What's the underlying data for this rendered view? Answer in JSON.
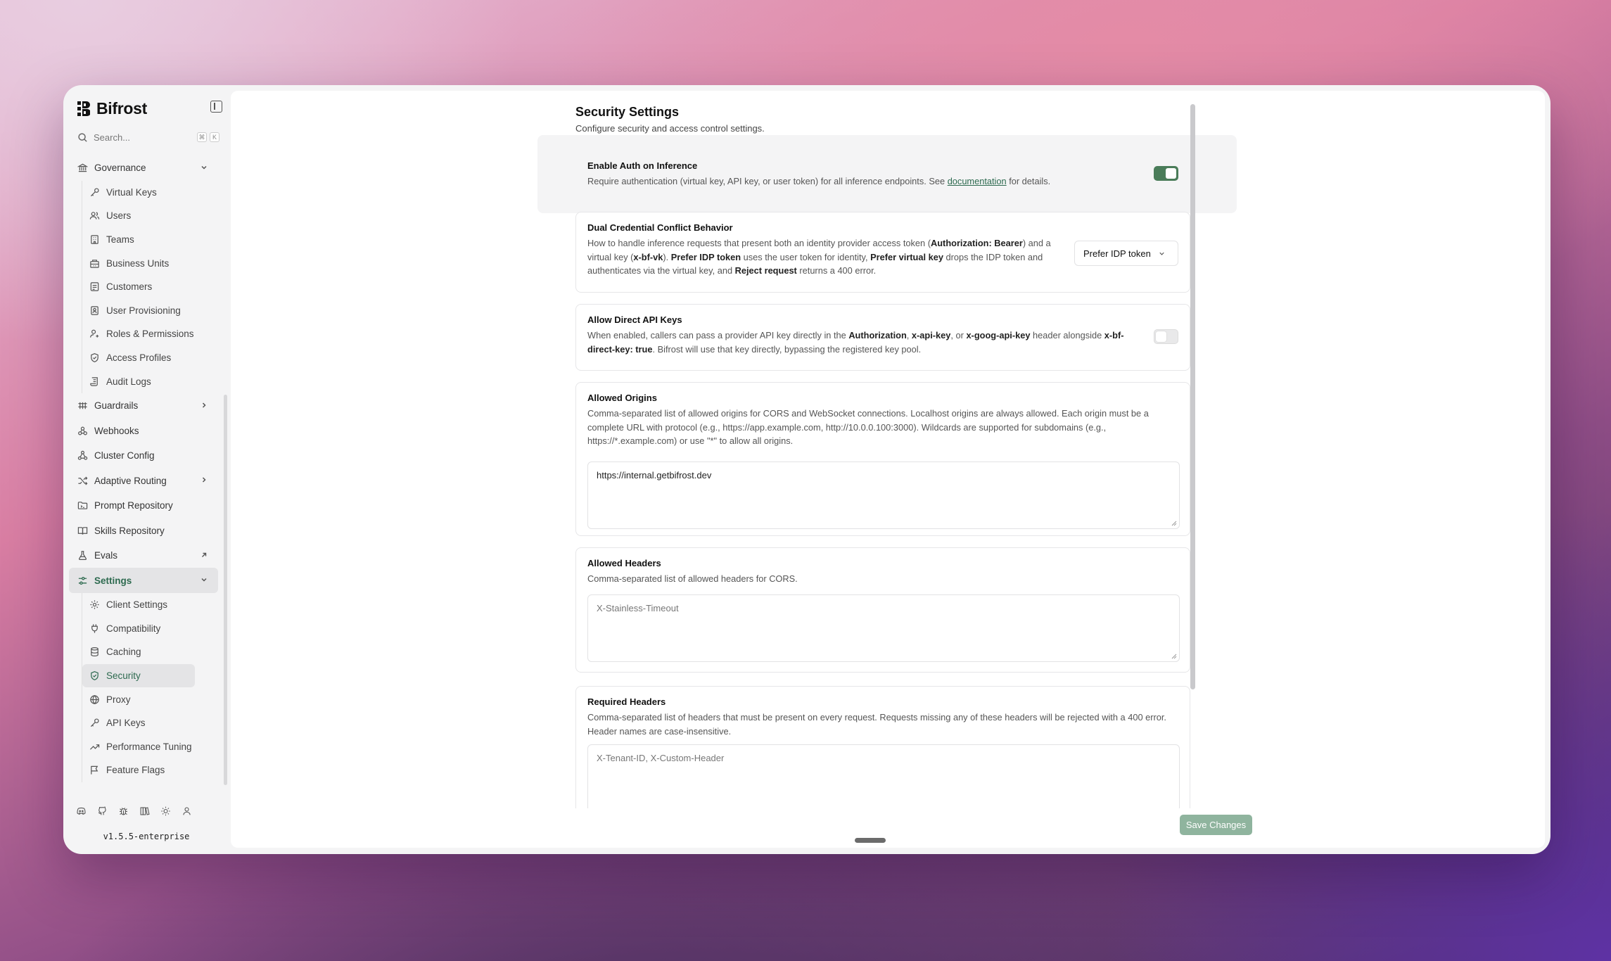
{
  "app": {
    "name": "Bifrost",
    "version": "v1.5.5-enterprise"
  },
  "search": {
    "placeholder": "Search...",
    "kbd": [
      "⌘",
      "K"
    ]
  },
  "sidebar": {
    "governance": {
      "label": "Governance",
      "items": [
        "Virtual Keys",
        "Users",
        "Teams",
        "Business Units",
        "Customers",
        "User Provisioning",
        "Roles & Permissions",
        "Access Profiles",
        "Audit Logs"
      ]
    },
    "top_items": [
      "Guardrails",
      "Webhooks",
      "Cluster Config",
      "Adaptive Routing",
      "Prompt Repository",
      "Skills Repository",
      "Evals"
    ],
    "settings": {
      "label": "Settings",
      "items": [
        "Client Settings",
        "Compatibility",
        "Caching",
        "Security",
        "Proxy",
        "API Keys",
        "Performance Tuning",
        "Feature Flags"
      ],
      "active": "Security"
    },
    "footer_icons": [
      "discord-icon",
      "github-icon",
      "bug-icon",
      "book-icon",
      "sun-icon",
      "user-icon"
    ]
  },
  "page": {
    "title": "Security Settings",
    "description": "Configure security and access control settings."
  },
  "sections": {
    "auth": {
      "title": "Enable Auth on Inference",
      "desc_before": "Require authentication (virtual key, API key, or user token) for all inference endpoints. See ",
      "link": "documentation",
      "desc_after": " for details.",
      "enabled": true
    },
    "dual": {
      "title": "Dual Credential Conflict Behavior",
      "p1": "How to handle inference requests that present both an identity provider access token (",
      "b1": "Authorization: Bearer",
      "p2": ") and a virtual key (",
      "b2": "x-bf-vk",
      "p3": "). ",
      "b3": "Prefer IDP token",
      "p4": " uses the user token for identity, ",
      "b4": "Prefer virtual key",
      "p5": " drops the IDP token and authenticates via the virtual key, and ",
      "b5": "Reject request",
      "p6": " returns a 400 error.",
      "select_value": "Prefer IDP token"
    },
    "direct": {
      "title": "Allow Direct API Keys",
      "p1": "When enabled, callers can pass a provider API key directly in the ",
      "b1": "Authorization",
      "p2": ", ",
      "b2": "x-api-key",
      "p3": ", or ",
      "b3": "x-goog-api-key",
      "p4": " header alongside ",
      "b4": "x-bf-direct-key: true",
      "p5": ". Bifrost will use that key directly, bypassing the registered key pool.",
      "enabled": false
    },
    "origins": {
      "title": "Allowed Origins",
      "desc": "Comma-separated list of allowed origins for CORS and WebSocket connections. Localhost origins are always allowed. Each origin must be a complete URL with protocol (e.g., https://app.example.com, http://10.0.0.100:3000). Wildcards are supported for subdomains (e.g., https://*.example.com) or use \"*\" to allow all origins.",
      "value": "https://internal.getbifrost.dev"
    },
    "headers": {
      "title": "Allowed Headers",
      "desc": "Comma-separated list of allowed headers for CORS.",
      "placeholder": "X-Stainless-Timeout"
    },
    "required": {
      "title": "Required Headers",
      "desc": "Comma-separated list of headers that must be present on every request. Requests missing any of these headers will be rejected with a 400 error. Header names are case-insensitive.",
      "placeholder": "X-Tenant-ID, X-Custom-Header"
    }
  },
  "actions": {
    "save_label": "Save Changes"
  },
  "colors": {
    "accent": "#2d6a4f",
    "toggle_on": "#4a7c59",
    "save_button": "#8fb49e"
  }
}
